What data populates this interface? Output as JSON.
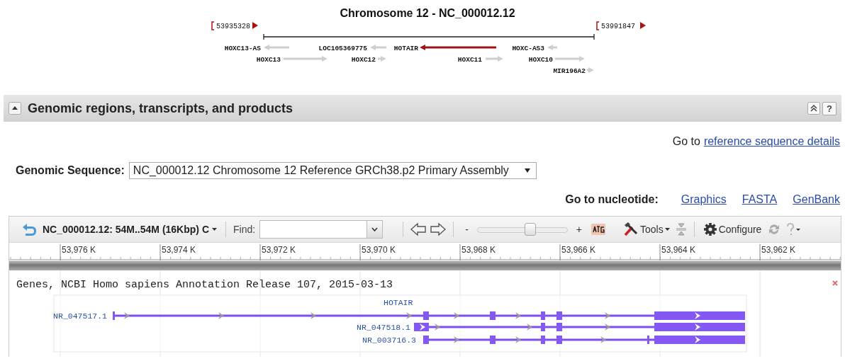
{
  "chromosome_map": {
    "title": "Chromosome 12 - NC_000012.12",
    "start": "53935328",
    "end": "53991847",
    "genes": [
      {
        "name": "HOXC13-AS",
        "kind": "reverse",
        "highlighted": false
      },
      {
        "name": "LOC105369775",
        "kind": "reverse",
        "highlighted": false
      },
      {
        "name": "HOTAIR",
        "kind": "reverse",
        "highlighted": true
      },
      {
        "name": "HOXC-AS3",
        "kind": "reverse",
        "highlighted": false
      },
      {
        "name": "HOXC13",
        "kind": "forward",
        "highlighted": false
      },
      {
        "name": "HOXC12",
        "kind": "forward",
        "highlighted": false
      },
      {
        "name": "HOXC11",
        "kind": "forward",
        "highlighted": false
      },
      {
        "name": "HOXC10",
        "kind": "forward",
        "highlighted": false
      },
      {
        "name": "MIR196A2",
        "kind": "forward",
        "highlighted": false
      }
    ]
  },
  "section": {
    "title": "Genomic regions, transcripts, and products",
    "expanded": true,
    "help_button": "?"
  },
  "reference_link": {
    "prefix": "Go to",
    "link": "reference sequence details"
  },
  "genomic_sequence": {
    "label": "Genomic Sequence:",
    "value": "NC_000012.12 Chromosome 12 Reference GRCh38.p2 Primary Assembly"
  },
  "nucleotide_links": {
    "label": "Go to nucleotide:",
    "links": [
      "Graphics",
      "FASTA",
      "GenBank"
    ]
  },
  "viewer": {
    "title": "NC_000012.12: 54M..54M (16Kbp) C",
    "find_label": "Find:",
    "zoom_minus": "-",
    "zoom_plus": "+",
    "zoom": {
      "level": 0.59
    },
    "tools": "Tools",
    "configure": "Configure",
    "ruler": [
      "53,976 K",
      "53,974 K",
      "53,972 K",
      "53,970 K",
      "53,968 K",
      "53,966 K",
      "53,964 K",
      "53,962 K"
    ],
    "track": {
      "title": "Genes, NCBI Homo sapiens Annotation Release 107, 2015-03-13",
      "gene_label": "HOTAIR",
      "transcripts": [
        {
          "name": "NR_047517.1"
        },
        {
          "name": "NR_047518.1"
        },
        {
          "name": "NR_003716.3"
        }
      ]
    }
  }
}
